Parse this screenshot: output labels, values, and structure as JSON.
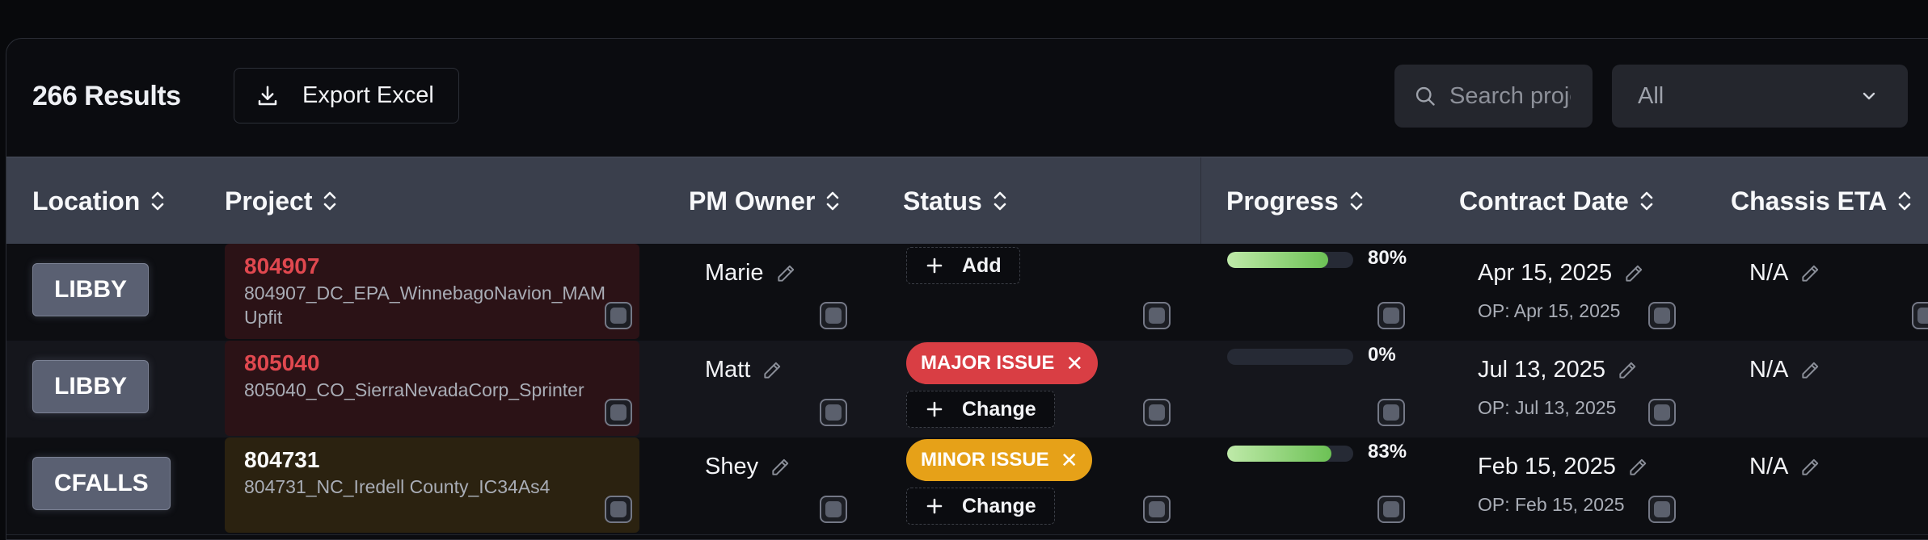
{
  "toolbar": {
    "results_label": "266 Results",
    "export_label": "Export Excel",
    "search_placeholder": "Search projects",
    "filter_value": "All"
  },
  "columns": {
    "location": "Location",
    "project": "Project",
    "pm_owner": "PM Owner",
    "status": "Status",
    "progress": "Progress",
    "contract_date": "Contract Date",
    "chassis_eta": "Chassis ETA"
  },
  "rows": [
    {
      "location": "LIBBY",
      "project_number": "804907",
      "project_name": "804907_DC_EPA_WinnebagoNavion_MAM Upfit",
      "pm_owner": "Marie",
      "status": "",
      "status_button": "Add",
      "progress_label": "80%",
      "progress_value": 80,
      "contract_date": "Apr 15, 2025",
      "op_date": "OP: Apr 15, 2025",
      "chassis_eta": "N/A"
    },
    {
      "location": "LIBBY",
      "project_number": "805040",
      "project_name": "805040_CO_SierraNevadaCorp_Sprinter",
      "pm_owner": "Matt",
      "status": "MAJOR ISSUE",
      "status_button": "Change",
      "progress_label": "0%",
      "progress_value": 0,
      "contract_date": "Jul 13, 2025",
      "op_date": "OP: Jul 13, 2025",
      "chassis_eta": "N/A"
    },
    {
      "location": "CFALLS",
      "project_number": "804731",
      "project_name": "804731_NC_Iredell County_IC34As4",
      "pm_owner": "Shey",
      "status": "MINOR ISSUE",
      "status_button": "Change",
      "progress_label": "83%",
      "progress_value": 83,
      "contract_date": "Feb 15, 2025",
      "op_date": "OP: Feb 15, 2025",
      "chassis_eta": "N/A"
    }
  ],
  "colors": {
    "major_issue": "#d93e44",
    "minor_issue": "#e6a118",
    "progress_fill": "#6cc155",
    "header_bg": "#3a3f4c"
  },
  "icons": {
    "export": "download-icon",
    "search": "search-icon",
    "sort": "sort-icon",
    "edit": "pencil-icon",
    "dropdown": "chevron-down-icon",
    "add": "plus-icon",
    "remove": "x-icon"
  }
}
